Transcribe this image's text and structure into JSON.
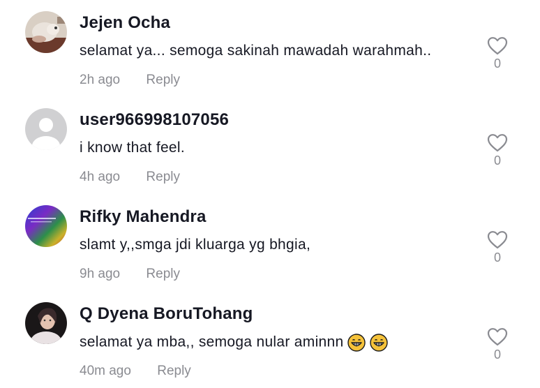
{
  "comments": [
    {
      "username": "Jejen Ocha",
      "text": "selamat ya... semoga sakinah mawadah warahmah..",
      "time": "2h ago",
      "reply_label": "Reply",
      "likes": "0",
      "avatar_icon": "cat-photo-avatar"
    },
    {
      "username": "user966998107056",
      "text": "i know that feel.",
      "time": "4h ago",
      "reply_label": "Reply",
      "likes": "0",
      "avatar_icon": "default-user-avatar"
    },
    {
      "username": "Rifky Mahendra",
      "text": "slamt y,,smga jdi kluarga yg bhgia,",
      "time": "9h ago",
      "reply_label": "Reply",
      "likes": "0",
      "avatar_icon": "gradient-avatar"
    },
    {
      "username": "Q Dyena BoruTohang",
      "text": "selamat ya mba,, semoga nular aminnn",
      "time": "40m ago",
      "reply_label": "Reply",
      "likes": "0",
      "avatar_icon": "person-photo-avatar",
      "emojis": [
        "grinning-face-emoji",
        "grinning-face-emoji"
      ]
    }
  ],
  "colors": {
    "username": "#161823",
    "meta": "#8a8b91",
    "heart_stroke": "#8a8b91"
  }
}
